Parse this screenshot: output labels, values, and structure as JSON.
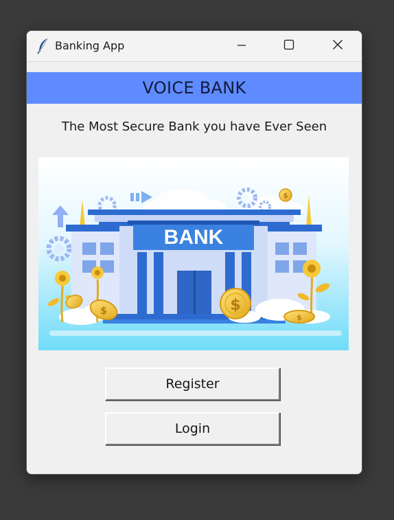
{
  "window": {
    "title": "Banking App"
  },
  "header": {
    "title": "VOICE BANK",
    "band_color": "#5e8bff"
  },
  "tagline": "The Most Secure Bank you have Ever Seen",
  "illustration": {
    "sign_text": "BANK",
    "currency_symbol": "$",
    "icons": [
      "gear-icon",
      "arrow-up-icon",
      "arrow-right-icon",
      "dollar-coin-icon",
      "flower-icon"
    ]
  },
  "buttons": {
    "register": "Register",
    "login": "Login"
  },
  "icons": {
    "app": "feather-icon",
    "minimize": "minimize-icon",
    "maximize": "maximize-icon",
    "close": "close-icon"
  }
}
